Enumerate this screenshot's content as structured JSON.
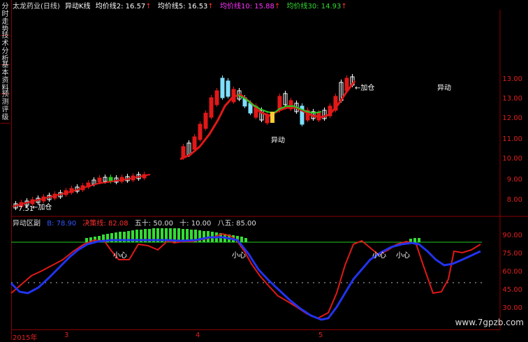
{
  "sidebar": {
    "tabs": [
      {
        "label": "分时走势"
      },
      {
        "label": "技术分析"
      },
      {
        "label": "基本资料"
      },
      {
        "label": "预测评级"
      }
    ]
  },
  "header": {
    "stock": "太龙药业(日线)",
    "indicator": "异动K线",
    "ma2": "均价线2: 16.57",
    "ma5": "均价线5: 16.53",
    "ma10": "均价线10: 15.88",
    "ma30": "均价线30: 14.93",
    "colors": {
      "stock": "#dddddd",
      "ma2": "#ffffff",
      "ma5": "#ffffff",
      "ma10": "#ff33ff",
      "ma30": "#33dd33",
      "arrow": "#ff3030"
    }
  },
  "main": {
    "annotations": [
      {
        "text": "←加仓",
        "id": "add1"
      },
      {
        "text": "←加仓",
        "id": "add2"
      },
      {
        "text": "异动",
        "id": "yd1"
      },
      {
        "text": "异动",
        "id": "yd2"
      },
      {
        "text": "7.51",
        "id": "low"
      }
    ],
    "price_axis": [
      "13.00",
      "12.00",
      "11.00",
      "10.00",
      "9.00",
      "8.00"
    ],
    "price_axis_top": "13.00"
  },
  "sub": {
    "title": "异动区副",
    "b_label": "B: 78.90",
    "decision": "决策线: 82.08",
    "wushi": "五十: 50.00",
    "shi": "十: 10.00",
    "bawu": "八五: 85.00",
    "axis": [
      "90.00",
      "75.00",
      "60.00",
      "45.00",
      "30.00"
    ],
    "careful_labels": [
      "小心",
      "小心",
      "小心",
      "小心"
    ]
  },
  "dates": [
    "2015年",
    "3",
    "4",
    "5"
  ],
  "watermark": "www.7gpzb.com"
}
